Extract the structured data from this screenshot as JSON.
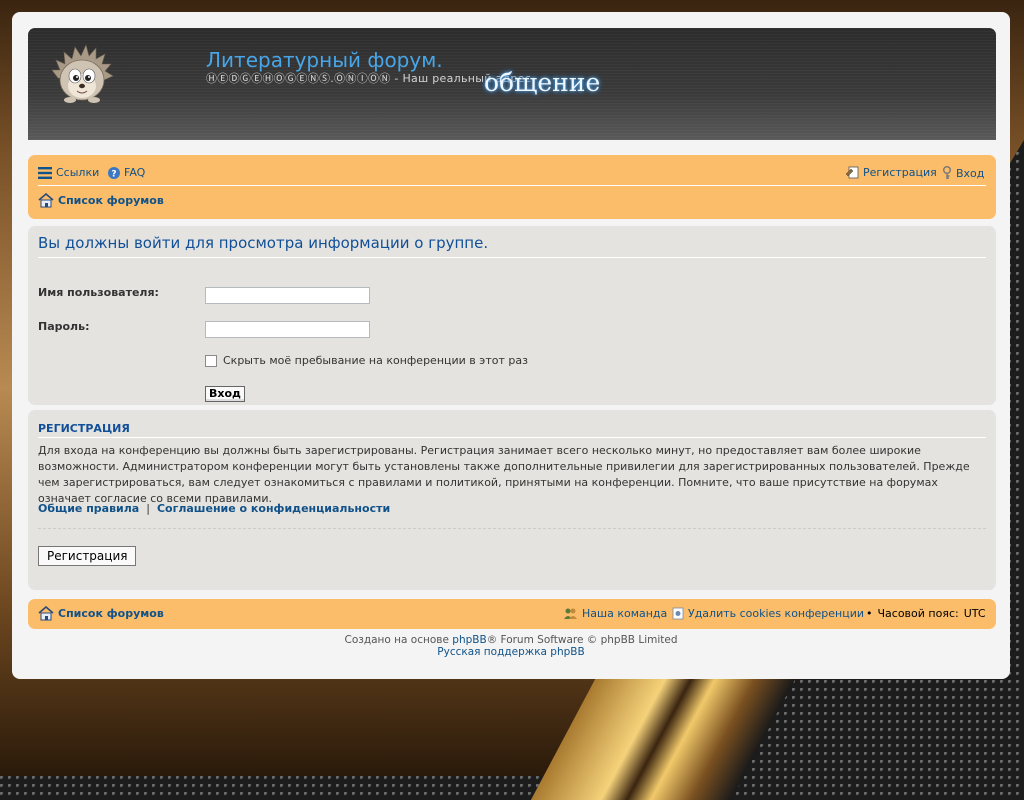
{
  "header": {
    "site_title": "Литературный форум.",
    "site_description": "ⒽⒺⒹⒼⒺⒽⓄⒼⒺⓃⓈ.ⓄⓃⒾⓄⓃ - Наш реальный адрес",
    "overlay_word": "общение"
  },
  "navbar": {
    "links_label": "Ссылки",
    "faq_label": "FAQ",
    "register_label": "Регистрация",
    "login_label": "Вход",
    "forum_index_label": "Список форумов"
  },
  "login": {
    "title": "Вы должны войти для просмотра информации о группе.",
    "username_label": "Имя пользователя:",
    "username_value": "",
    "password_label": "Пароль:",
    "password_value": "",
    "hide_status_label": "Скрыть моё пребывание на конференции в этот раз",
    "submit_label": "Вход"
  },
  "registration": {
    "title": "Регистрация",
    "text": "Для входа на конференцию вы должны быть зарегистрированы. Регистрация занимает всего несколько минут, но предоставляет вам более широкие возможности. Администратором конференции могут быть установлены также дополнительные привилегии для зарегистрированных пользователей. Прежде чем зарегистрироваться, вам следует ознакомиться с правилами и политикой, принятыми на конференции. Помните, что ваше присутствие на форумах означает согласие со всеми правилами.",
    "terms_link": "Общие правила",
    "separator": "|",
    "privacy_link": "Соглашение о конфиденциальности",
    "register_button": "Регистрация"
  },
  "footer": {
    "forum_index_label": "Список форумов",
    "team_label": "Наша команда",
    "delete_cookies_label": "Удалить cookies конференции",
    "bullet": "•",
    "timezone_label": "Часовой пояс:",
    "timezone_value": "UTC",
    "powered_prefix": "Создано на основе",
    "phpbb_link": "phpBB",
    "powered_suffix": "® Forum Software © phpBB Limited",
    "support_link": "Русская поддержка phpBB"
  },
  "colors": {
    "accent": "#105289",
    "navbar_bg": "#fbbd6a",
    "panel_bg": "#e5e3df",
    "title_blue": "#48a6e8"
  },
  "icons": [
    "hedgehog-logo-icon",
    "menu-icon",
    "help-icon",
    "register-icon",
    "key-icon",
    "home-icon",
    "team-icon",
    "cookie-icon"
  ]
}
